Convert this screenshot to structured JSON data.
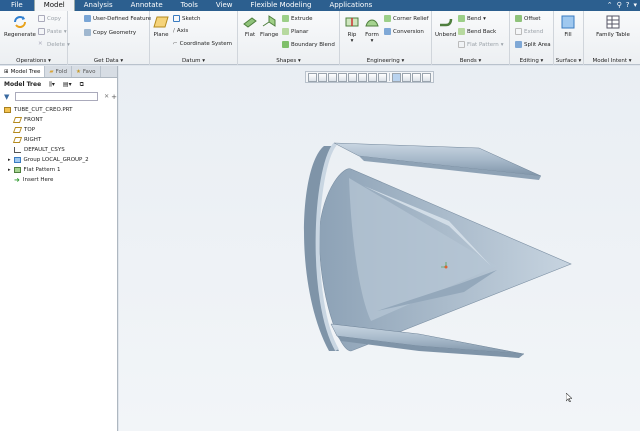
{
  "tabs": [
    "File",
    "Model",
    "Analysis",
    "Annotate",
    "Tools",
    "View",
    "Flexible Modeling",
    "Applications"
  ],
  "active_tab": "Model",
  "ribbon": {
    "operations": {
      "label": "Operations",
      "regenerate": "Regenerate",
      "copy": "Copy",
      "paste": "Paste",
      "delete": "Delete"
    },
    "get_data": {
      "label": "Get Data",
      "udf": "User-Defined Feature",
      "copy_geometry": "Copy Geometry"
    },
    "datum": {
      "label": "Datum",
      "plane": "Plane",
      "sketch": "Sketch",
      "axis": "Axis",
      "coord": "Coordinate System"
    },
    "shapes": {
      "label": "Shapes",
      "flat": "Flat",
      "flange": "Flange",
      "extrude": "Extrude",
      "planar": "Planar",
      "boundary": "Boundary Blend"
    },
    "engineering": {
      "label": "Engineering",
      "rip": "Rip",
      "form": "Form",
      "corner_relief": "Corner Relief",
      "conversion": "Conversion"
    },
    "bends": {
      "label": "Bends",
      "unbend": "Unbend",
      "bend": "Bend",
      "bend_back": "Bend Back",
      "flat_pattern": "Flat Pattern"
    },
    "editing": {
      "label": "Editing",
      "offset": "Offset",
      "extend": "Extend",
      "split_area": "Split Area"
    },
    "surface": {
      "label": "Surface",
      "fill": "Fill"
    },
    "model_intent": {
      "label": "Model Intent",
      "family_table": "Family Table"
    }
  },
  "panel": {
    "tabs": [
      "Model Tree",
      "Fold",
      "Favo"
    ],
    "title": "Model Tree",
    "tree": [
      {
        "label": "TUBE_CUT_CREO.PRT",
        "icon": "part-icon",
        "indent": 0
      },
      {
        "label": "FRONT",
        "icon": "datum-plane-icon",
        "indent": 1
      },
      {
        "label": "TOP",
        "icon": "datum-plane-icon",
        "indent": 1
      },
      {
        "label": "RIGHT",
        "icon": "datum-plane-icon",
        "indent": 1
      },
      {
        "label": "DEFAULT_CSYS",
        "icon": "csys-icon",
        "indent": 1
      },
      {
        "label": "Group LOCAL_GROUP_2",
        "icon": "group-icon",
        "indent": 1
      },
      {
        "label": "Flat Pattern 1",
        "icon": "flat-pattern-icon",
        "indent": 1
      },
      {
        "label": "Insert Here",
        "icon": "insert-here-icon",
        "indent": 1
      }
    ]
  },
  "colors": {
    "accent": "#2c5f8f",
    "model": "#a9bccd",
    "model_dark": "#7f94a8",
    "model_light": "#d4dee8"
  }
}
